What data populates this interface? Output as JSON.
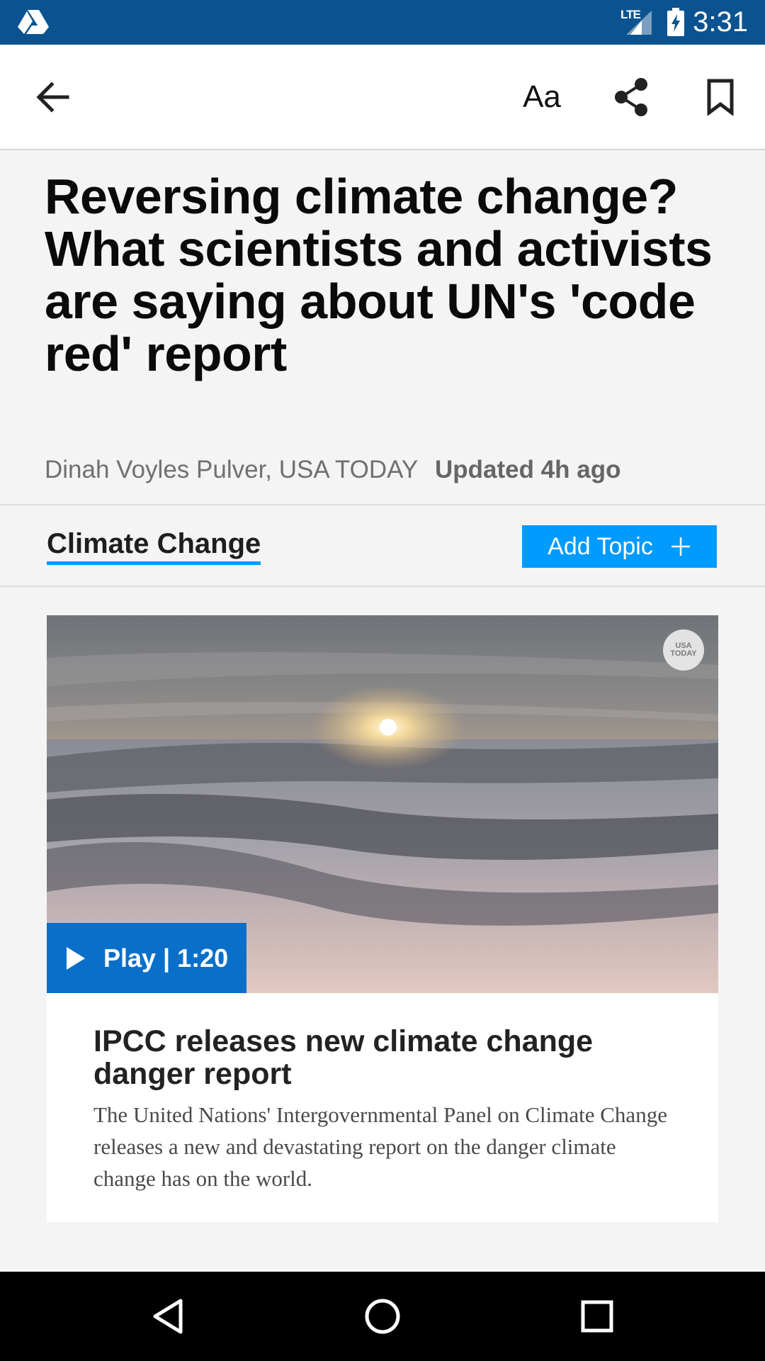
{
  "status_bar": {
    "network": "LTE",
    "time": "3:31",
    "icons": [
      "app-drive-icon",
      "signal-icon",
      "battery-charging-icon"
    ]
  },
  "toolbar": {
    "icons": [
      "back-arrow-icon",
      "text-size-icon",
      "share-icon",
      "bookmark-icon"
    ],
    "text_size_label": "Aa"
  },
  "article": {
    "headline": "Reversing climate change? What scientists and activists are saying about UN's 'code red' report",
    "author": "Dinah Voyles Pulver, USA TODAY",
    "updated": "Updated 4h ago"
  },
  "topic": {
    "label": "Climate Change",
    "add_button_label": "Add Topic",
    "accent_color": "#009bff"
  },
  "video_card": {
    "badge": "USA\nTODAY",
    "play_label": "Play | 1:20",
    "title": "IPCC releases new climate change danger report",
    "summary": "The United Nations' Intergovernmental Panel on Climate Change releases a new and devastating report on the danger climate change has on the world.",
    "play_button_color": "#0a6fc9"
  },
  "nav_bar": {
    "icons": [
      "nav-back-icon",
      "nav-home-icon",
      "nav-recents-icon"
    ]
  }
}
